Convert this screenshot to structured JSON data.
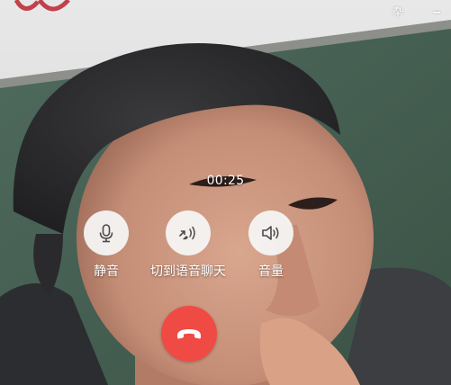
{
  "window": {
    "pin_glyph": "卆",
    "minimize_glyph": "−"
  },
  "call": {
    "timer": "00:25"
  },
  "actions": {
    "mute_label": "静音",
    "voice_label": "切到语音聊天",
    "speaker_label": "音量"
  },
  "colors": {
    "hangup": "#f04a45",
    "button_bg": "#f6f6f6",
    "text": "#ffffff"
  },
  "icons": {
    "mute": "microphone-icon",
    "voice": "switch-to-voice-icon",
    "speaker": "speaker-icon",
    "hangup": "hang-up-phone-icon"
  }
}
